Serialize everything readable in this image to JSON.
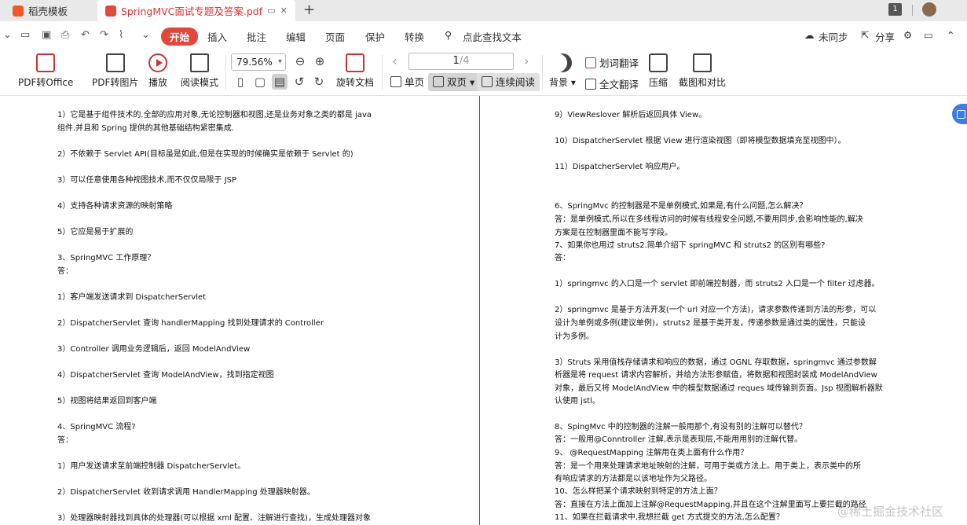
{
  "tabs": {
    "tab1": "稻壳模板",
    "tab2": "SpringMVC面试专题及答案.pdf",
    "new_tab": "+",
    "right_badge": "1"
  },
  "menu": {
    "start": "开始",
    "insert": "插入",
    "annotate": "批注",
    "edit": "编辑",
    "page": "页面",
    "protect": "保护",
    "convert": "转换",
    "search": "点此查找文本",
    "sync": "未同步",
    "share": "分享"
  },
  "ribbon": {
    "pdf_office": "PDF转Office",
    "pdf_image": "PDF转图片",
    "play": "播放",
    "read_mode": "阅读模式",
    "zoom": "79.56%",
    "rotate": "旋转文档",
    "page_current": "1",
    "page_total": "/4",
    "single": "单页",
    "double": "双页",
    "continuous": "连续阅读",
    "background": "背景",
    "word_translate": "划词翻译",
    "full_translate": "全文翻译",
    "compress": "压缩",
    "screenshot": "截图和对比"
  },
  "left_page": [
    "1）它是基于组件技术的.全部的应用对象,无论控制器和视图,还是业务对象之类的都是  java",
    "组件.并且和 Spring 提供的其他基础结构紧密集成.",
    "2）不依赖于 Servlet API(目标虽是如此,但是在实现的时候确实是依赖于 Servlet 的)",
    "3）可以任意使用各种视图技术,而不仅仅局限于 JSP",
    "4）支持各种请求资源的映射策略",
    "5）它应是易于扩展的",
    "3、SpringMVC 工作原理？",
    "答：",
    "1）客户端发送请求到 DispatcherServlet",
    "2）DispatcherServlet 查询 handlerMapping 找到处理请求的 Controller",
    "3）Controller 调用业务逻辑后，返回 ModelAndView",
    "4）DispatcherServlet 查询 ModelAndView，找到指定视图",
    "5）视图将结果返回到客户端",
    "4、SpringMVC 流程?",
    "答：",
    "1）用户发送请求至前端控制器 DispatcherServlet。",
    "2）DispatcherServlet 收到请求调用 HandlerMapping 处理器映射器。",
    "3）处理器映射器找到具体的处理器(可以根据 xml 配置、注解进行查找)，生成处理器对象"
  ],
  "right_page": [
    "9）ViewReslover 解析后返回具体 View。",
    "10）DispatcherServlet 根据 View 进行渲染视图（即将模型数据填充至视图中）。",
    "11）DispatcherServlet 响应用户。",
    "6、SpringMvc 的控制器是不是单例模式,如果是,有什么问题,怎么解决？",
    "答：是单例模式,所以在多线程访问的时候有线程安全问题,不要用同步,会影响性能的,解决",
    "方案是在控制器里面不能写字段。",
    "7、如果你也用过 struts2.简单介绍下 springMVC 和 struts2 的区别有哪些?",
    "答：",
    "1）springmvc 的入口是一个 servlet 即前端控制器，而 struts2 入口是一个 filter 过虑器。",
    "2）springmvc 是基于方法开发(一个 url 对应一个方法)，请求参数传递到方法的形参，可以",
    "设计为单例或多例(建议单例)，struts2 是基于类开发，传递参数是通过类的属性，只能设",
    "计为多例。",
    "3）Struts 采用值栈存储请求和响应的数据，通过 OGNL 存取数据，springmvc 通过参数解",
    "析器是将 request 请求内容解析，并给方法形参赋值，将数据和视图封装成 ModelAndView",
    "对象，最后又将 ModelAndView 中的模型数据通过 reques 域传输到页面。Jsp 视图解析器默",
    "认使用 jstl。",
    "8、SpingMvc 中的控制器的注解一般用那个,有没有别的注解可以替代？",
    "答：一般用@Conntroller 注解,表示是表现层,不能用用别的注解代替。",
    "9、  @RequestMapping 注解用在类上面有什么作用？",
    "答：是一个用来处理请求地址映射的注解，可用于类或方法上。用于类上，表示类中的所",
    "有响应请求的方法都是以该地址作为父路径。",
    "10、怎么样把某个请求映射到特定的方法上面？",
    "答：直接在方法上面加上注解@RequestMapping,并且在这个注解里面写上要拦截的路径",
    "11、如果在拦截请求中,我想拦截 get 方式提交的方法,怎么配置？"
  ],
  "watermark": "@稀土掘金技术社区"
}
